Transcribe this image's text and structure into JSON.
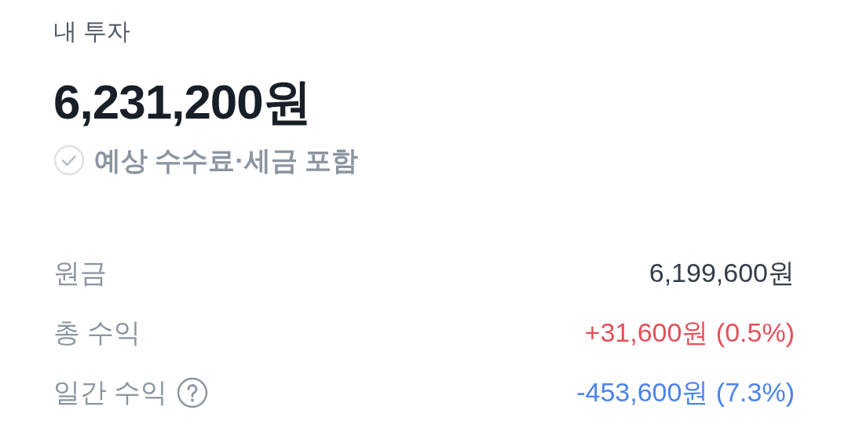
{
  "title": "내 투자",
  "total": "6,231,200원",
  "fee_option": {
    "label": "예상 수수료·세금 포함",
    "checked": false
  },
  "rows": [
    {
      "label": "원금",
      "help": false,
      "value": "6,199,600원",
      "color": "#333d4b"
    },
    {
      "label": "총 수익",
      "help": false,
      "value": "+31,600원 (0.5%)",
      "color": "#e5505a"
    },
    {
      "label": "일간 수익",
      "help": true,
      "value": "-453,600원 (7.3%)",
      "color": "#4a84ef"
    }
  ]
}
